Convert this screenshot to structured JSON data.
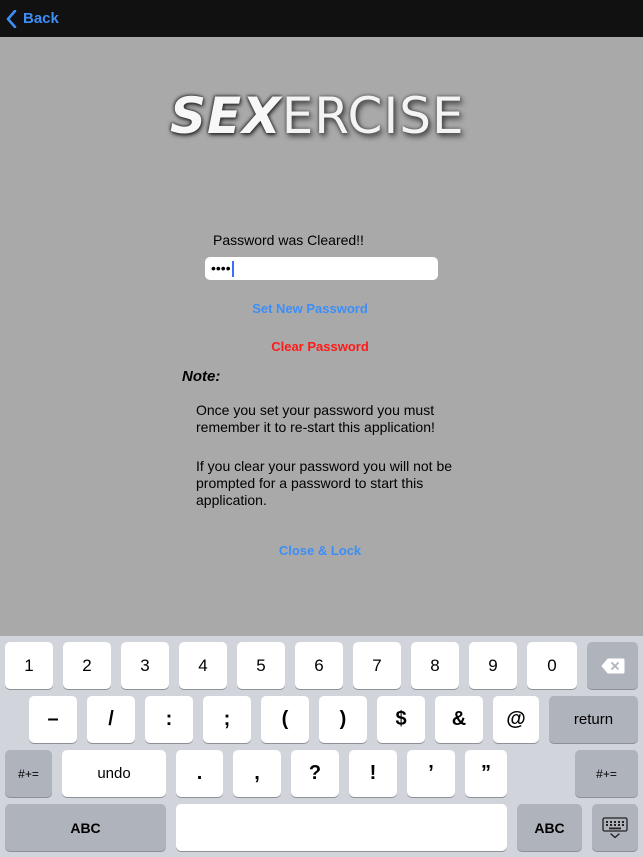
{
  "navbar": {
    "back_label": "Back"
  },
  "logo": {
    "bold_part": "SEX",
    "light_part": "ERCISE"
  },
  "status_text": "Password was Cleared!!",
  "password_field": {
    "value": "••••"
  },
  "set_password_label": "Set New Password",
  "clear_password_label": "Clear Password",
  "note_label": "Note:",
  "note_lines": [
    "Once you set your password you must remember it to re-start this application!",
    "If you clear your password you will not be prompted for a password to start this application."
  ],
  "close_lock_label": "Close & Lock",
  "keyboard": {
    "row1": [
      "1",
      "2",
      "3",
      "4",
      "5",
      "6",
      "7",
      "8",
      "9",
      "0"
    ],
    "row2": [
      "–",
      "/",
      ":",
      ";",
      "(",
      ")",
      "$",
      "&",
      "@"
    ],
    "return_label": "return",
    "row3_left": "#+=",
    "undo_label": "undo",
    "row3": [
      ".",
      ",",
      "?",
      "!",
      "’",
      "”"
    ],
    "row3_right": "#+=",
    "abc_left": "ABC",
    "abc_right": "ABC",
    "backspace_icon": "backspace-icon",
    "hide_keyboard_icon": "keyboard-hide-icon"
  }
}
